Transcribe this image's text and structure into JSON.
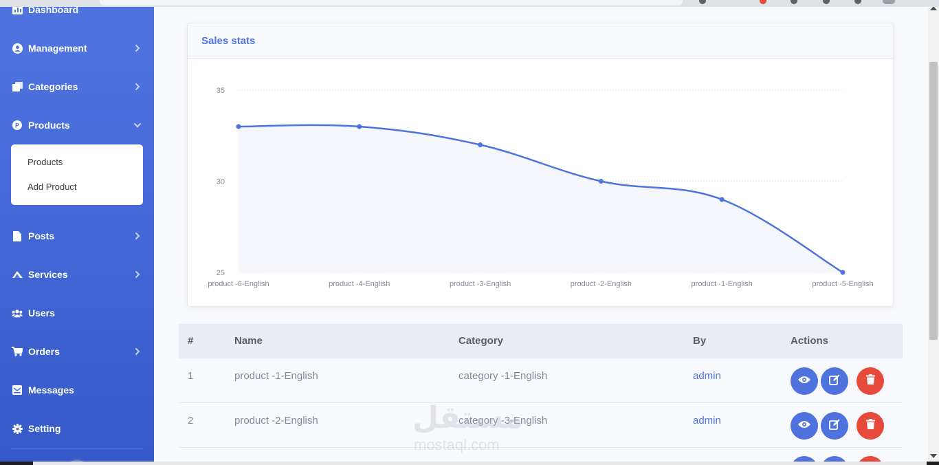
{
  "sidebar": {
    "items": [
      {
        "label": "Dashboard",
        "icon": "dashboard-icon",
        "chevron": false
      },
      {
        "label": "Management",
        "icon": "user-circle-icon",
        "chevron": true
      },
      {
        "label": "Categories",
        "icon": "copy-icon",
        "chevron": true
      },
      {
        "label": "Products",
        "icon": "product-p-icon",
        "chevron": true,
        "expanded": true
      },
      {
        "label": "Posts",
        "icon": "file-icon",
        "chevron": true
      },
      {
        "label": "Services",
        "icon": "services-icon",
        "chevron": true
      },
      {
        "label": "Users",
        "icon": "users-icon",
        "chevron": false
      },
      {
        "label": "Orders",
        "icon": "cart-icon",
        "chevron": true
      },
      {
        "label": "Messages",
        "icon": "envelope-icon",
        "chevron": false
      },
      {
        "label": "Setting",
        "icon": "gear-icon",
        "chevron": false
      }
    ],
    "submenu": {
      "items": [
        "Products",
        "Add Product"
      ]
    }
  },
  "card": {
    "title": "Sales stats"
  },
  "chart_data": {
    "type": "area",
    "categories": [
      "product -6-English",
      "product -4-English",
      "product -3-English",
      "product -2-English",
      "product -1-English",
      "product -5-English"
    ],
    "series": [
      {
        "values": [
          33,
          33,
          32,
          30,
          29,
          25
        ]
      }
    ],
    "ylim": [
      25,
      35
    ],
    "yticks": [
      25,
      30,
      35
    ],
    "grid": true,
    "colors": {
      "line": "#4e73df",
      "fill": "#f5f6fb"
    }
  },
  "table": {
    "headers": [
      "#",
      "Name",
      "Category",
      "By",
      "Actions"
    ],
    "rows": [
      {
        "num": "1",
        "name": "product -1-English",
        "category": "category -1-English",
        "by": "admin"
      },
      {
        "num": "2",
        "name": "product -2-English",
        "category": "category -3-English",
        "by": "admin"
      }
    ],
    "actions": [
      "eye-icon",
      "edit-icon",
      "trash-icon"
    ]
  },
  "watermark": {
    "arabic": "مستقل",
    "latin": "mostaql.com"
  },
  "colors": {
    "primary": "#4e73df",
    "danger": "#e74a3b",
    "text": "#858796"
  }
}
